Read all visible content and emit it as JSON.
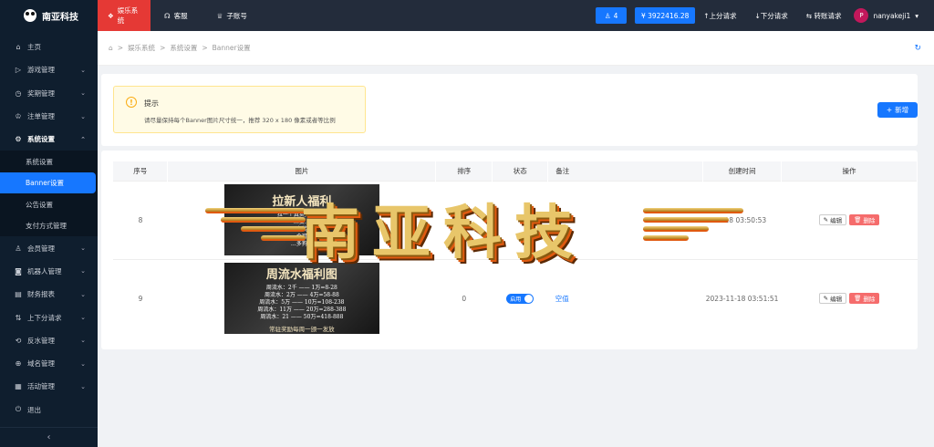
{
  "logo": {
    "text": "南亚科技"
  },
  "sidebar": {
    "items": [
      {
        "label": "主页",
        "icon": "home-icon",
        "glyph": "⌂"
      },
      {
        "label": "游戏管理",
        "icon": "play-icon",
        "glyph": "▷"
      },
      {
        "label": "奖期管理",
        "icon": "clock-icon",
        "glyph": "◷"
      },
      {
        "label": "注单管理",
        "icon": "trophy-icon",
        "glyph": "♔"
      },
      {
        "label": "系统设置",
        "icon": "gear-icon",
        "glyph": "⚙"
      }
    ],
    "sub_items": [
      {
        "label": "系统设置"
      },
      {
        "label": "Banner设置"
      },
      {
        "label": "公告设置"
      },
      {
        "label": "支付方式管理"
      }
    ],
    "items2": [
      {
        "label": "会员管理",
        "icon": "user-icon",
        "glyph": "♙"
      },
      {
        "label": "机器人管理",
        "icon": "robot-icon",
        "glyph": "◙"
      },
      {
        "label": "财务报表",
        "icon": "report-icon",
        "glyph": "▤"
      },
      {
        "label": "上下分请求",
        "icon": "arrows-icon",
        "glyph": "⇅"
      },
      {
        "label": "反水管理",
        "icon": "refund-icon",
        "glyph": "⟲"
      },
      {
        "label": "域名管理",
        "icon": "globe-icon",
        "glyph": "⊕"
      },
      {
        "label": "活动管理",
        "icon": "calendar-icon",
        "glyph": "▦"
      },
      {
        "label": "退出",
        "icon": "logout-icon",
        "glyph": "⏻"
      }
    ],
    "collapse_glyph": "‹"
  },
  "header": {
    "tabs": [
      {
        "label": "娱乐系统",
        "glyph": "❖"
      },
      {
        "label": "客服",
        "glyph": "☊"
      },
      {
        "label": "子账号",
        "glyph": "♕"
      }
    ],
    "user_count": "4",
    "balance": "¥ 3922416.28",
    "up_request": "↑上分请求",
    "down_request": "↓下分请求",
    "transfer_request": "⇆ 转账请求",
    "avatar_letter": "P",
    "username": "nanyakeji1"
  },
  "breadcrumb": {
    "home_glyph": "⌂",
    "items": [
      "娱乐系统",
      "系统设置",
      "Banner设置"
    ],
    "separator": ">"
  },
  "tip": {
    "title": "提示",
    "text": "请尽量保持每个Banner图片尺寸统一，推荐 320 x 180 像素或者等比例"
  },
  "add_button": {
    "label": "新增",
    "glyph": "+"
  },
  "table": {
    "headers": [
      "序号",
      "图片",
      "排序",
      "状态",
      "备注",
      "创建时间",
      "操作"
    ],
    "rows": [
      {
        "id": "8",
        "image": {
          "title": "拉新人福利",
          "lines": [
            "拉一个真实充值玩家",
            "…安…",
            "…家奖…",
            "…个可…",
            "…多狗…"
          ],
          "foot": ""
        },
        "sort": "",
        "status": "",
        "remark": "完",
        "created": "…18 03:50:53"
      },
      {
        "id": "9",
        "image": {
          "title": "周流水福利图",
          "lines": [
            "周流水：2千 —— 1万=8-28",
            "周流水：2万 —— 4万=58-88",
            "周流水：5万 —— 10万=108-238",
            "周流水：11万 —— 20万=288-388",
            "周流水：21 —— 50万=418-888"
          ],
          "foot": "常驻奖励每周一颁一发放"
        },
        "sort": "0",
        "status": "启用",
        "remark": "空值",
        "created": "2023-11-18 03:51:51"
      }
    ],
    "edit_label": "编辑",
    "delete_label": "删除",
    "edit_glyph": "✎",
    "delete_glyph": "🗑"
  },
  "watermark": {
    "text": "南亚科技"
  },
  "colors": {
    "sidebar_bg": "#0f1e2e",
    "header_bg": "#232c3b",
    "accent": "#1677ff",
    "active_tab": "#e53935",
    "danger": "#f56c6c"
  }
}
